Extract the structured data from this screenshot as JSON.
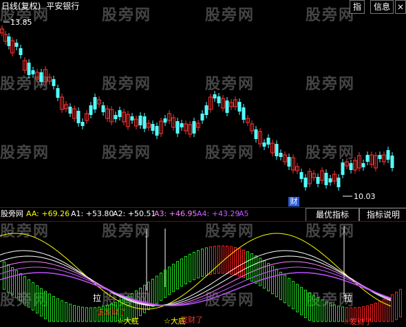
{
  "header": {
    "period": "日线(复权)",
    "stock_name": "平安银行"
  },
  "toolbar": {
    "btn1": "指",
    "btn2": "信息"
  },
  "price_labels": {
    "high": "13.85",
    "low": "10.03"
  },
  "cai_badge": "财",
  "panel_buttons": {
    "best": "最优指标",
    "explain": "指标说明"
  },
  "watermark": "股旁网",
  "indicator": {
    "name": "股旁网",
    "aa": "AA: +69.26",
    "a1": "A1: +53.80",
    "a2": "A2: +50.51",
    "a3": "A3: +46.95",
    "a4": "A4: +43.29",
    "a5": "A5"
  },
  "signals": {
    "la1": "拉",
    "la2": "拉",
    "s1": "该发财了",
    "s2": "☆大底",
    "s3": "☆大底",
    "s4": "发财了",
    "s5": "☆发财了"
  },
  "colors": {
    "up": "#ff3232",
    "down": "#54ffff",
    "aa": "#ffff00",
    "a1": "#ffffff",
    "a2": "#ffffff",
    "a3": "#ff80ff",
    "a4": "#c060ff",
    "a5": "#c050ff"
  }
}
